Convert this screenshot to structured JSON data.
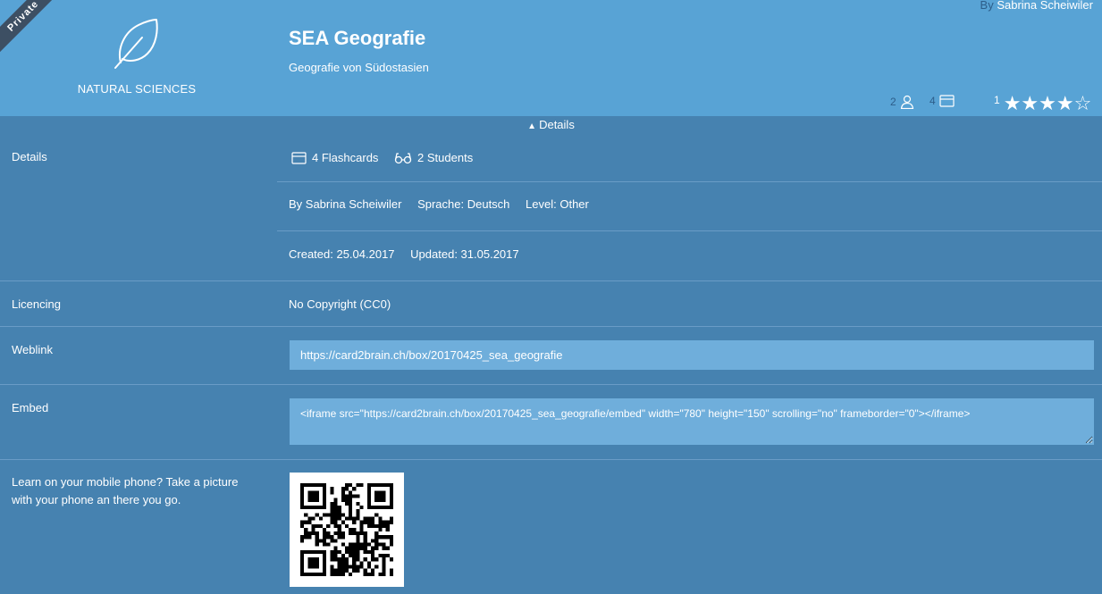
{
  "header": {
    "ribbon": "Private",
    "category": "NATURAL SCIENCES",
    "category_icon": "leaf-icon",
    "title": "SEA Geografie",
    "subtitle": "Geografie von Südostasien",
    "author_prefix": "By",
    "author_name": "Sabrina Scheiwiler",
    "students_count": "2",
    "cards_count": "4",
    "rating_count": "1",
    "rating_value": 4,
    "rating_max": 5,
    "colors": {
      "header_bg": "#58a3d5",
      "body_bg": "#4682b0",
      "muted": "#2d5e8a"
    }
  },
  "details_toggle": {
    "label": "Details",
    "icon": "chevron-up-icon"
  },
  "rows": {
    "details": {
      "label": "Details",
      "flashcards": "4 Flashcards",
      "students": "2 Students",
      "author": "By Sabrina Scheiwiler",
      "language": "Sprache: Deutsch",
      "level": "Level: Other",
      "created": "Created: 25.04.2017",
      "updated": "Updated: 31.05.2017"
    },
    "licencing": {
      "label": "Licencing",
      "value": "No Copyright (CC0)"
    },
    "weblink": {
      "label": "Weblink",
      "value": "https://card2brain.ch/box/20170425_sea_geografie"
    },
    "embed": {
      "label": "Embed",
      "value": "<iframe src=\"https://card2brain.ch/box/20170425_sea_geografie/embed\" width=\"780\" height=\"150\" scrolling=\"no\" frameborder=\"0\"></iframe>"
    },
    "mobile": {
      "label": "Learn on your mobile phone? Take a picture with your phone an there you go."
    }
  }
}
